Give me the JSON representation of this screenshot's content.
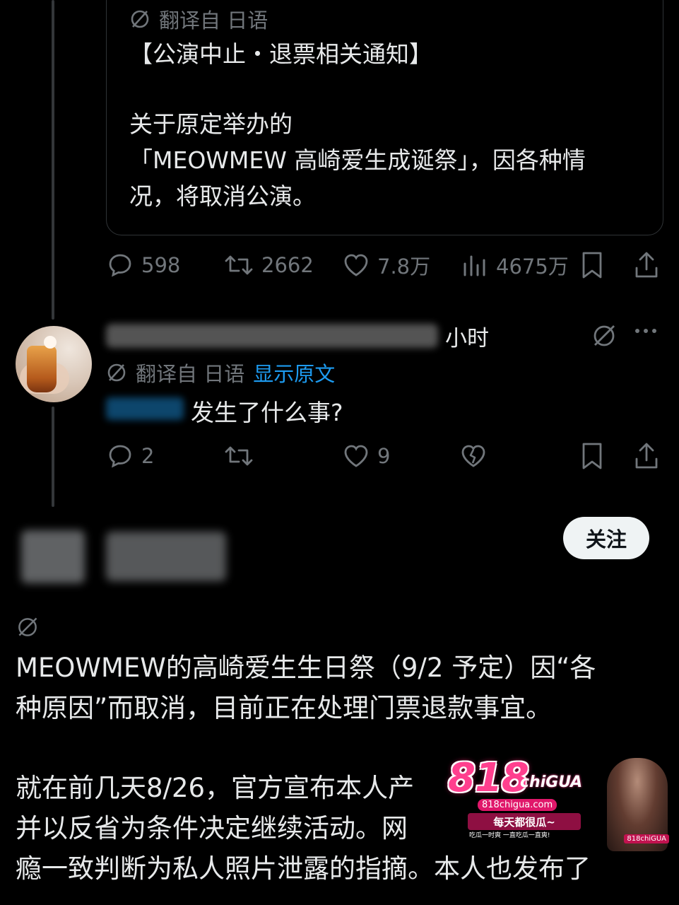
{
  "quote_tweet": {
    "translated_label": "翻译自 日语",
    "lines": [
      "【公演中止・退票相关通知】",
      "",
      "关于原定举办的",
      "「MEOWMEW 高崎爱生成诞祭」，因各种情",
      "况，将取消公演。"
    ]
  },
  "tweet_actions": {
    "replies": "598",
    "retweets": "2662",
    "likes": "7.8万",
    "views": "4675万"
  },
  "reply": {
    "time_suffix": "小时",
    "translated_label": "翻译自 日语",
    "show_original": "显示原文",
    "text": "发生了什么事?",
    "replies": "2",
    "likes": "9"
  },
  "next_post": {
    "follow_label": "关注",
    "lines_1": [
      "MEOWMEW的高崎爱生生日祭（9/2 予定）因“各",
      "种原因”而取消，目前正在处理门票退款事宜。"
    ],
    "lines_2": [
      "就在前几天8/26，官方宣布本人产",
      "并以反省为条件决定继续活动。网",
      "瘾一致判断为私人照片泄露的指摘。本人也发布了"
    ]
  },
  "watermark": {
    "brand": "818",
    "brand_suffix": "chiGUA",
    "url": "818chigua.com",
    "slogan": "每天都很瓜~",
    "sub": "吃瓜一时爽 一直吃瓜一直爽!",
    "side": "818chiGUA"
  },
  "colors": {
    "background": "#000000",
    "text": "#e7e9ea",
    "muted": "#71767b",
    "link": "#1d9bf0",
    "border": "#2f3336"
  }
}
